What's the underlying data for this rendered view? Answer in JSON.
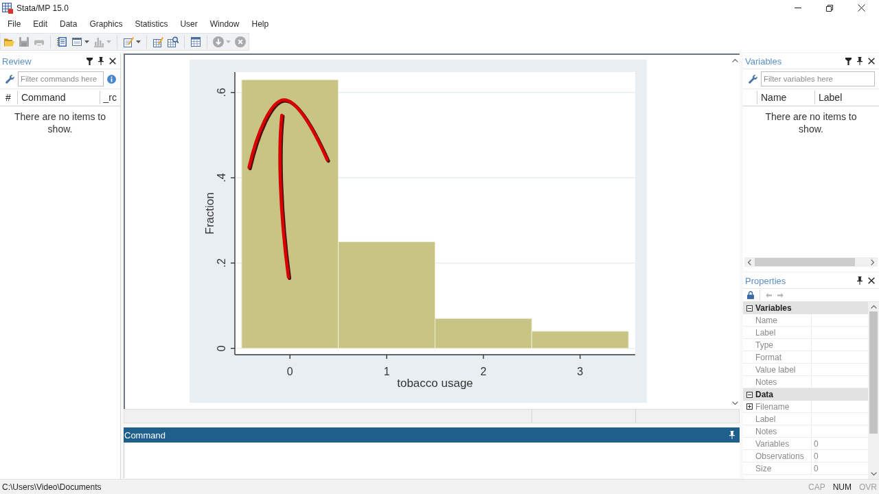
{
  "window": {
    "title": "Stata/MP 15.0"
  },
  "menu": [
    "File",
    "Edit",
    "Data",
    "Graphics",
    "Statistics",
    "User",
    "Window",
    "Help"
  ],
  "toolbar": [
    [
      {
        "kind": "open",
        "disabled": false,
        "dropdown": false
      },
      {
        "kind": "save",
        "disabled": true,
        "dropdown": false
      },
      {
        "kind": "print",
        "disabled": true,
        "dropdown": false
      }
    ],
    [
      {
        "kind": "log",
        "disabled": false,
        "dropdown": false
      },
      {
        "kind": "viewer",
        "disabled": false,
        "dropdown": true
      },
      {
        "kind": "graph",
        "disabled": true,
        "dropdown": true
      }
    ],
    [
      {
        "kind": "dofile",
        "disabled": false,
        "dropdown": true
      }
    ],
    [
      {
        "kind": "editor",
        "disabled": false,
        "dropdown": false
      },
      {
        "kind": "browser",
        "disabled": false,
        "dropdown": false
      }
    ],
    [
      {
        "kind": "manager",
        "disabled": false,
        "dropdown": false
      }
    ],
    [
      {
        "kind": "more",
        "disabled": true,
        "dropdown": true
      },
      {
        "kind": "break",
        "disabled": true,
        "dropdown": false
      }
    ]
  ],
  "review": {
    "title": "Review",
    "filter": {
      "placeholder": "Filter commands here"
    },
    "columns": [
      "#",
      "Command",
      "_rc"
    ],
    "empty_text": "There are no items to show."
  },
  "graph": {
    "chart_data": {
      "type": "bar",
      "xlabel": "tobacco usage",
      "ylabel": "Fraction",
      "x": [
        0,
        1,
        2,
        3
      ],
      "values": [
        0.63,
        0.25,
        0.07,
        0.04
      ],
      "xlim": [
        -0.57,
        3.57
      ],
      "ylim": [
        -0.015,
        0.648
      ],
      "xticks": [
        0,
        1,
        2,
        3
      ],
      "yticks": [
        0,
        {
          "value": 0.2,
          "label": ".2"
        },
        {
          "value": 0.4,
          "label": ".4"
        },
        {
          "value": 0.6,
          "label": ".6"
        }
      ],
      "grid": true
    }
  },
  "command": {
    "title": "Command"
  },
  "variables": {
    "title": "Variables",
    "filter": {
      "placeholder": "Filter variables here"
    },
    "columns": [
      "Name",
      "Label"
    ],
    "empty_text": "There are no items to show."
  },
  "properties": {
    "title": "Properties",
    "sections": [
      {
        "title": "Variables",
        "expanded": true,
        "rows": [
          {
            "label": "Name"
          },
          {
            "label": "Label"
          },
          {
            "label": "Type"
          },
          {
            "label": "Format"
          },
          {
            "label": "Value label"
          },
          {
            "label": "Notes"
          }
        ]
      },
      {
        "title": "Data",
        "expanded": true,
        "rows": [
          {
            "label": "Filename",
            "expanded": false
          },
          {
            "label": "Label"
          },
          {
            "label": "Notes"
          },
          {
            "label": "Variables",
            "value": "0"
          },
          {
            "label": "Observations",
            "value": "0"
          },
          {
            "label": "Size",
            "value": "0"
          }
        ]
      }
    ]
  },
  "status_bar": {
    "path": "C:\\Users\\Video\\Documents",
    "indicators": [
      {
        "label": "CAP",
        "on": false
      },
      {
        "label": "NUM",
        "on": true
      },
      {
        "label": "OVR",
        "on": false
      }
    ]
  }
}
